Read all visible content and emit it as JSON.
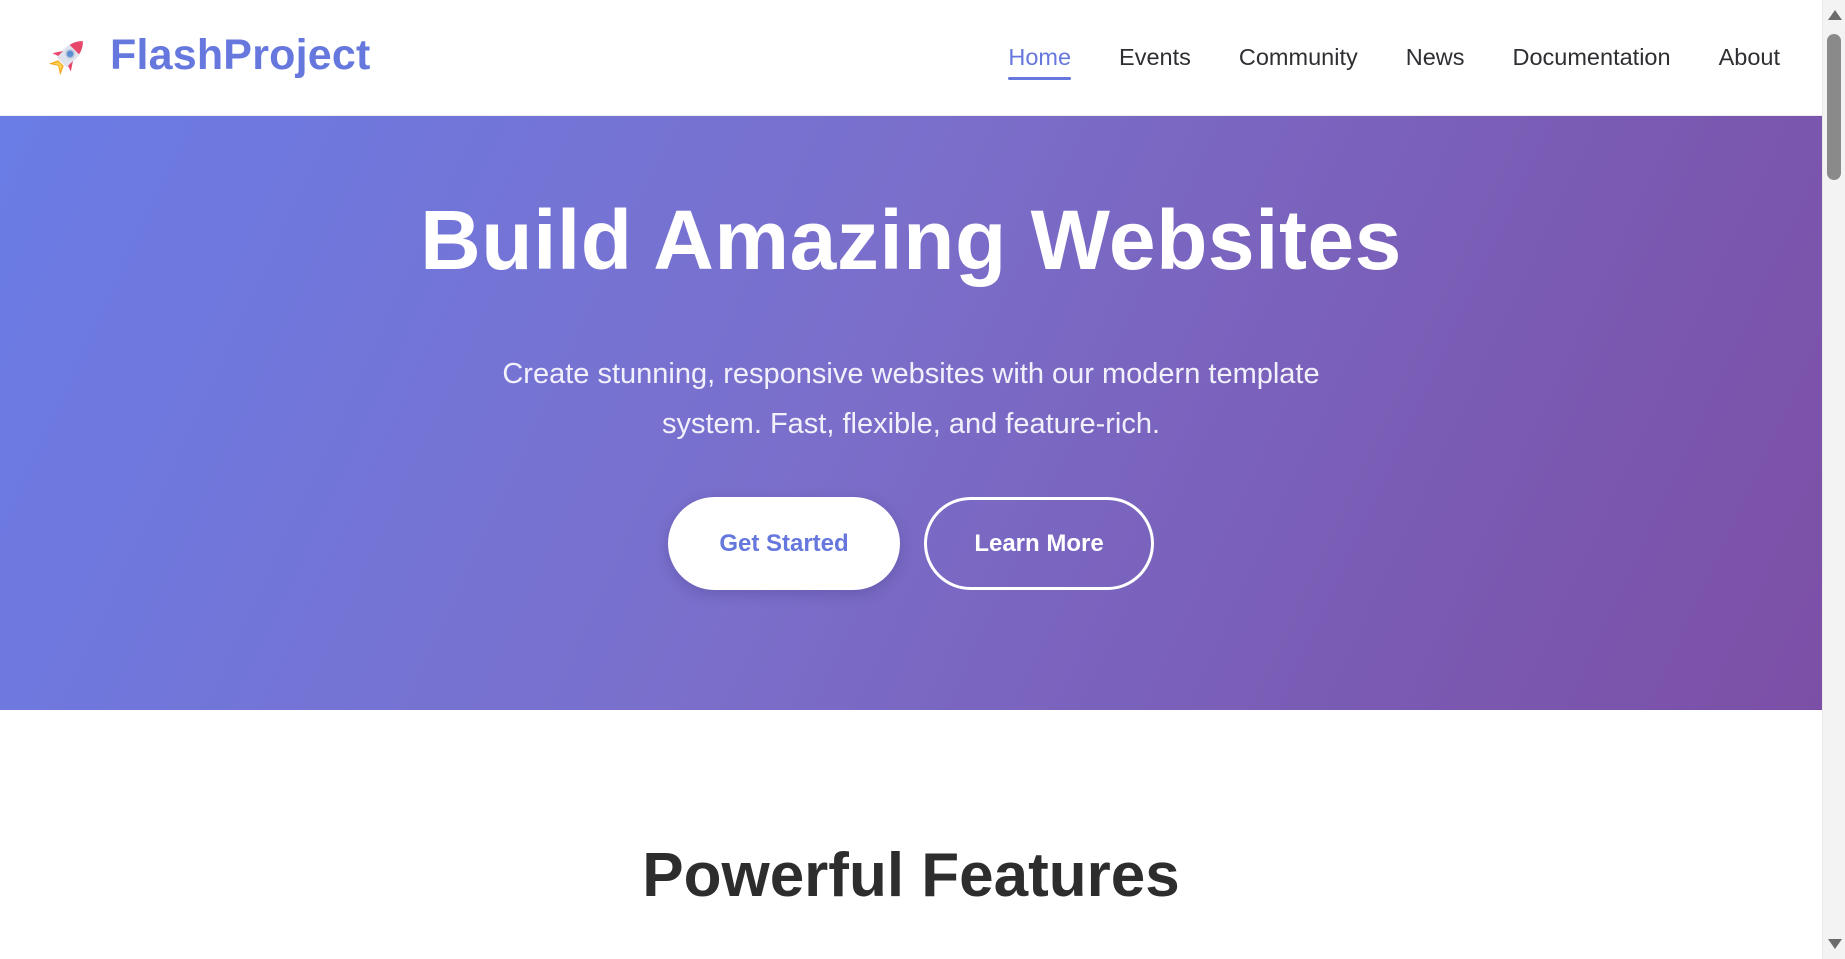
{
  "brand": {
    "name": "FlashProject",
    "icon": "rocket-icon",
    "color": "#6677dd"
  },
  "nav": {
    "items": [
      {
        "label": "Home",
        "active": true
      },
      {
        "label": "Events",
        "active": false
      },
      {
        "label": "Community",
        "active": false
      },
      {
        "label": "News",
        "active": false
      },
      {
        "label": "Documentation",
        "active": false
      },
      {
        "label": "About",
        "active": false
      }
    ],
    "active_color": "#6677dd"
  },
  "hero": {
    "title": "Build Amazing Websites",
    "subtitle": "Create stunning, responsive websites with our modern template system. Fast, flexible, and feature-rich.",
    "primary_button": "Get Started",
    "secondary_button": "Learn More",
    "gradient_start": "#6a7ce6",
    "gradient_end": "#7c4fa6"
  },
  "features": {
    "title": "Powerful Features"
  }
}
